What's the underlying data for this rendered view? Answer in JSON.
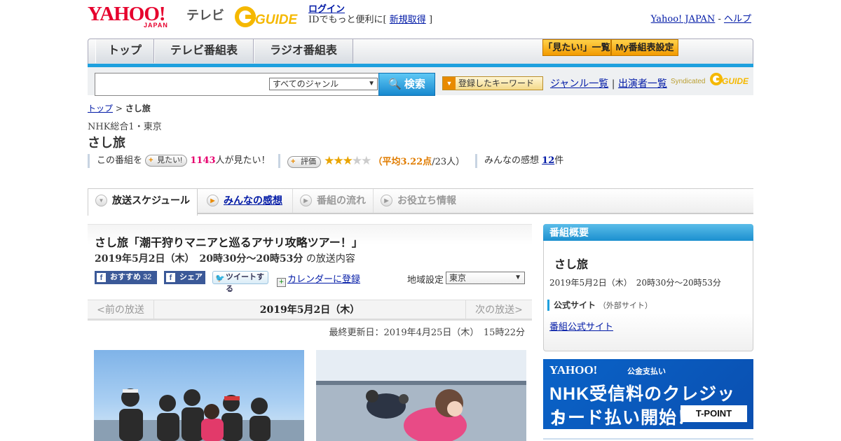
{
  "header": {
    "logo": "YAHOO!",
    "logo_sub": "JAPAN",
    "service": "テレビ",
    "gguide": "GUIDE",
    "login": "ログイン",
    "id_text": "IDでもっと便利に[",
    "signup": "新規取得",
    "id_close": "]",
    "yahoo_japan": "Yahoo! JAPAN",
    "sep": "-",
    "help": "ヘルプ"
  },
  "nav": {
    "tabs": [
      "トップ",
      "テレビ番組表",
      "ラジオ番組表"
    ],
    "mitai_list": "「見たい!」一覧",
    "my_schedule": "My番組表設定"
  },
  "search": {
    "genre": "すべてのジャンル",
    "button": "検索",
    "keyword_btn": "登録したキーワード",
    "genre_list": "ジャンル一覧",
    "divider": "|",
    "performer_list": "出演者一覧",
    "syndicated": "Syndicated",
    "syndicated_logo": "GUIDE"
  },
  "breadcrumb": {
    "top": "トップ",
    "sep": ">",
    "current": "さし旅"
  },
  "program": {
    "channel": "NHK総合1・東京",
    "title": "さし旅",
    "mitai_prefix": "この番組を",
    "mitai_btn": "見たい!",
    "mitai_count": "1143",
    "mitai_suffix": "人が見たい！",
    "rate_btn": "評価",
    "rating": 3.22,
    "stars_on": "★★★",
    "stars_off": "★★",
    "avg_open": "（",
    "avg_text": "平均3.22点",
    "avg_count": "/23人）",
    "impressions_label": "みんなの感想",
    "impressions_count": "12",
    "impressions_unit": "件"
  },
  "content_tabs": [
    "放送スケジュール",
    "みんなの感想",
    "番組の流れ",
    "お役立ち情報"
  ],
  "episode": {
    "title": "さし旅「潮干狩りマニアと巡るアサリ攻略ツアー！」",
    "datetime": "2019年5月2日（木）　20時30分～20時53分",
    "datetime_suffix": "の放送内容",
    "fb_recommend": "おすすめ",
    "fb_count": "32",
    "fb_share": "シェア",
    "tweet": "ツイートする",
    "calendar": "カレンダーに登録",
    "region_label": "地域設定",
    "region": "東京",
    "prev": "<前の放送",
    "current_date": "2019年5月2日（木）",
    "next": "次の放送>",
    "updated": "最終更新日：2019年4月25日（木）　15時22分"
  },
  "sidebar": {
    "heading": "番組概要",
    "title": "さし旅",
    "datetime": "2019年5月2日（木）　20時30分～20時53分",
    "official_label": "公式サイト",
    "official_note": "（外部サイト）",
    "official_link": "番組公式サイト"
  },
  "banner": {
    "logo": "YAHOO!",
    "sub": "公金支払い",
    "line1": "NHK受信料のクレジット",
    "line2": "カード払い開始！",
    "tpoint": "T-POINT"
  },
  "colors": {
    "accent_blue": "#1ea0de",
    "yahoo_red": "#e6002d",
    "link": "#0019a6",
    "pink": "#e6006e",
    "orange": "#e07c00"
  }
}
